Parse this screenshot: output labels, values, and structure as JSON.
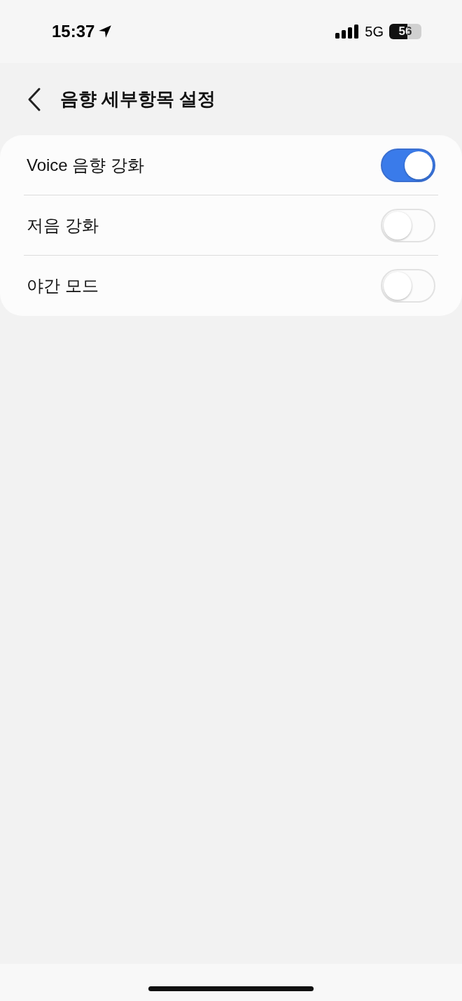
{
  "status_bar": {
    "time": "15:37",
    "network": "5G",
    "battery": "56"
  },
  "header": {
    "title": "음향 세부항목 설정"
  },
  "settings": [
    {
      "label": "Voice 음향 강화",
      "on": true
    },
    {
      "label": "저음 강화",
      "on": false
    },
    {
      "label": "야간 모드",
      "on": false
    }
  ]
}
